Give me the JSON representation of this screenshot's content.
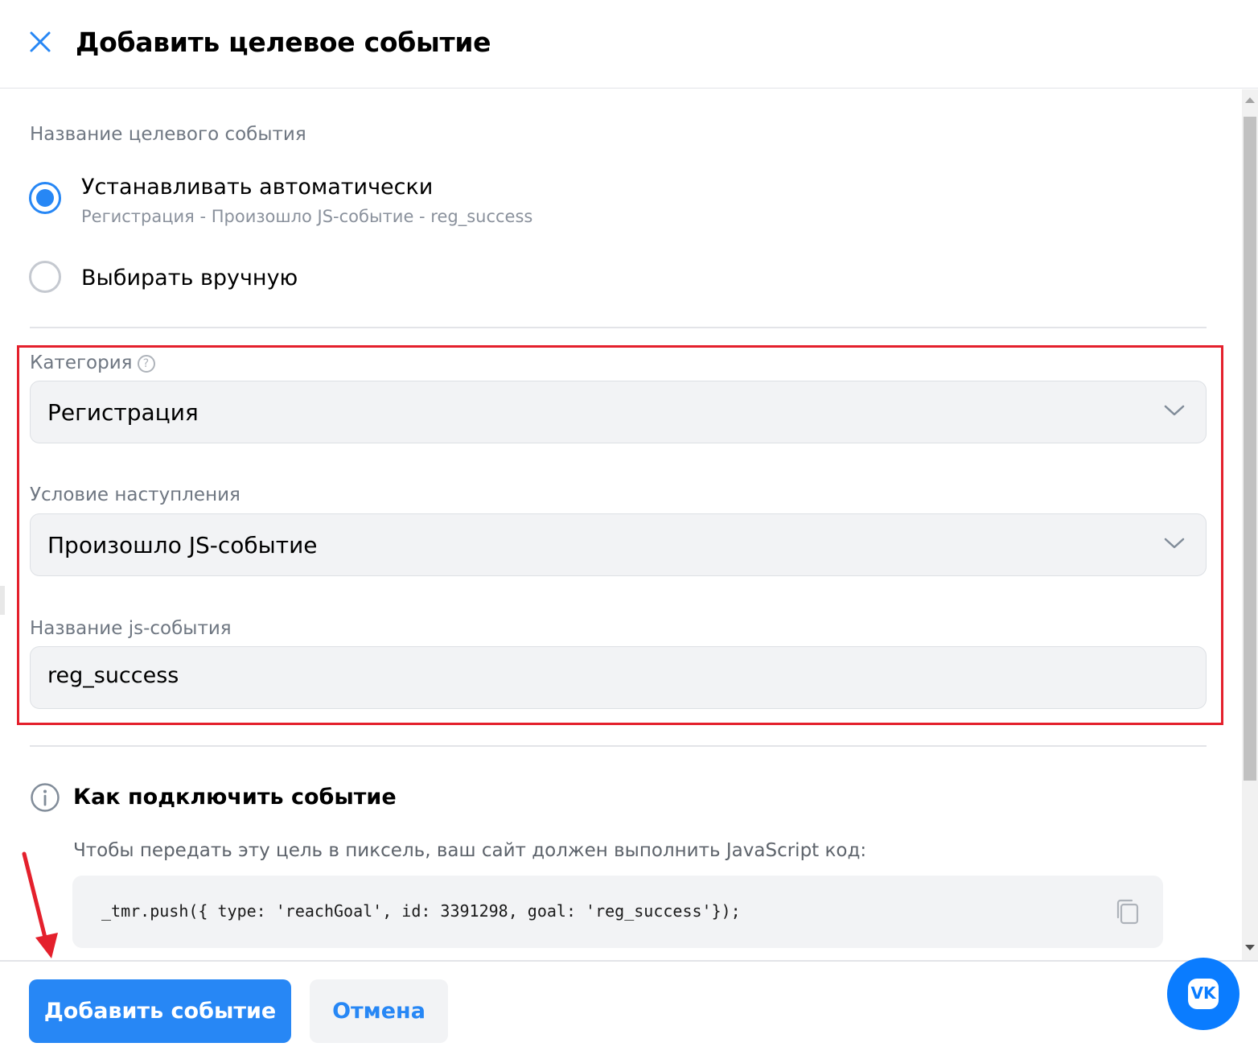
{
  "header": {
    "title": "Добавить целевое событие"
  },
  "goal_name": {
    "section_label": "Название целевого события",
    "options": [
      {
        "label": "Устанавливать автоматически",
        "sublabel": "Регистрация - Произошло JS-событие - reg_success",
        "checked": true
      },
      {
        "label": "Выбирать вручную",
        "checked": false
      }
    ]
  },
  "form": {
    "category": {
      "label": "Категория",
      "value": "Регистрация"
    },
    "condition": {
      "label": "Условие наступления",
      "value": "Произошло JS-событие"
    },
    "js_event": {
      "label": "Название js-события",
      "value": "reg_success"
    }
  },
  "how_to": {
    "title": "Как подключить событие",
    "description": "Чтобы передать эту цель в пиксель, ваш сайт должен выполнить JavaScript код:",
    "code": "_tmr.push({ type: 'reachGoal', id: 3391298, goal: 'reg_success'});"
  },
  "footer": {
    "add_label": "Добавить событие",
    "cancel_label": "Отмена"
  },
  "fab": {
    "label": "VK"
  },
  "colors": {
    "accent": "#2787f5",
    "highlight": "#e4202c",
    "field_bg": "#f2f3f5"
  }
}
